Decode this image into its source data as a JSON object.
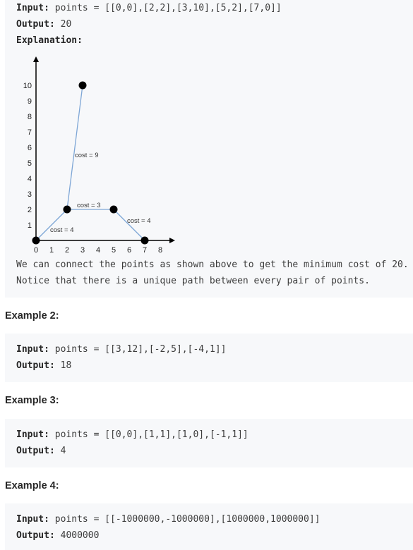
{
  "example1": {
    "input_label": "Input:",
    "input_value": "points = [[0,0],[2,2],[3,10],[5,2],[7,0]]",
    "output_label": "Output:",
    "output_value": "20",
    "explanation_label": "Explanation:",
    "explanation_lines": [
      "We can connect the points as shown above to get the minimum cost of 20.",
      "Notice that there is a unique path between every pair of points."
    ]
  },
  "examples": [
    {
      "heading": "Example 2:",
      "input_label": "Input:",
      "input_value": "points = [[3,12],[-2,5],[-4,1]]",
      "output_label": "Output:",
      "output_value": "18"
    },
    {
      "heading": "Example 3:",
      "input_label": "Input:",
      "input_value": "points = [[0,0],[1,1],[1,0],[-1,1]]",
      "output_label": "Output:",
      "output_value": "4"
    },
    {
      "heading": "Example 4:",
      "input_label": "Input:",
      "input_value": "points = [[-1000000,-1000000],[1000000,1000000]]",
      "output_label": "Output:",
      "output_value": "4000000"
    }
  ],
  "chart_data": {
    "type": "scatter",
    "points": [
      [
        0,
        0
      ],
      [
        2,
        2
      ],
      [
        3,
        10
      ],
      [
        5,
        2
      ],
      [
        7,
        0
      ]
    ],
    "edges": [
      {
        "from": [
          0,
          0
        ],
        "to": [
          2,
          2
        ],
        "label": "cost = 4"
      },
      {
        "from": [
          2,
          2
        ],
        "to": [
          3,
          10
        ],
        "label": "cost = 9"
      },
      {
        "from": [
          2,
          2
        ],
        "to": [
          5,
          2
        ],
        "label": "cost = 3"
      },
      {
        "from": [
          5,
          2
        ],
        "to": [
          7,
          0
        ],
        "label": "cost = 4"
      }
    ],
    "x_ticks": [
      "0",
      "1",
      "2",
      "3",
      "4",
      "5",
      "6",
      "7",
      "8"
    ],
    "y_ticks": [
      "1",
      "2",
      "3",
      "4",
      "5",
      "6",
      "7",
      "8",
      "9",
      "10"
    ],
    "xlim": [
      0,
      8
    ],
    "ylim": [
      0,
      10
    ],
    "point_color": "#000000",
    "edge_color": "#7ea6d6"
  }
}
